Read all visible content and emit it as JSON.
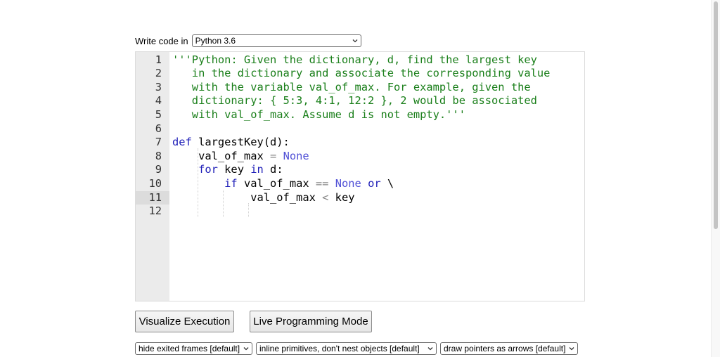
{
  "language_bar": {
    "label": "Write code in",
    "selected": "Python 3.6"
  },
  "editor": {
    "active_line": 11,
    "line_numbers": [
      "1",
      "2",
      "3",
      "4",
      "5",
      "6",
      "7",
      "8",
      "9",
      "10",
      "11",
      "12"
    ],
    "lines": [
      [
        {
          "t": "'''Python: Given the dictionary, d, find the largest key",
          "c": "str"
        }
      ],
      [
        {
          "t": "   in the dictionary and associate the corresponding value",
          "c": "str"
        }
      ],
      [
        {
          "t": "   with the variable val_of_max. For example, given the",
          "c": "str"
        }
      ],
      [
        {
          "t": "   dictionary: { 5:3, 4:1, 12:2 }, 2 would be associated",
          "c": "str"
        }
      ],
      [
        {
          "t": "   with val_of_max. Assume d is not empty.'''",
          "c": "str"
        }
      ],
      [],
      [
        {
          "t": "def",
          "c": "kw"
        },
        {
          "t": " largestKey(d):",
          "c": ""
        }
      ],
      [
        {
          "t": "    val_of_max ",
          "c": ""
        },
        {
          "t": "=",
          "c": "op"
        },
        {
          "t": " ",
          "c": ""
        },
        {
          "t": "None",
          "c": "const"
        }
      ],
      [
        {
          "t": "    ",
          "c": ""
        },
        {
          "t": "for",
          "c": "kw"
        },
        {
          "t": " key ",
          "c": ""
        },
        {
          "t": "in",
          "c": "kw"
        },
        {
          "t": " d:",
          "c": ""
        }
      ],
      [
        {
          "t": "        ",
          "c": ""
        },
        {
          "t": "if",
          "c": "kw"
        },
        {
          "t": " val_of_max ",
          "c": ""
        },
        {
          "t": "==",
          "c": "op"
        },
        {
          "t": " ",
          "c": ""
        },
        {
          "t": "None",
          "c": "const"
        },
        {
          "t": " ",
          "c": ""
        },
        {
          "t": "or",
          "c": "kw"
        },
        {
          "t": " \\",
          "c": ""
        }
      ],
      [
        {
          "t": "            val_of_max ",
          "c": ""
        },
        {
          "t": "<",
          "c": "op"
        },
        {
          "t": " key",
          "c": ""
        }
      ],
      []
    ]
  },
  "buttons": {
    "visualize": "Visualize Execution",
    "live": "Live Programming Mode"
  },
  "options": {
    "frames": "hide exited frames [default]",
    "primitives": "inline primitives, don't nest objects [default]",
    "pointers": "draw pointers as arrows [default]"
  },
  "icons": {
    "dropdown": "chevron-down-icon"
  },
  "colors": {
    "string": "#1a7f1a",
    "keyword": "#1f1fb8",
    "constant": "#5151d6",
    "operator": "#888888",
    "gutter": "#ebebeb",
    "active_line": "#dcdcdc"
  }
}
